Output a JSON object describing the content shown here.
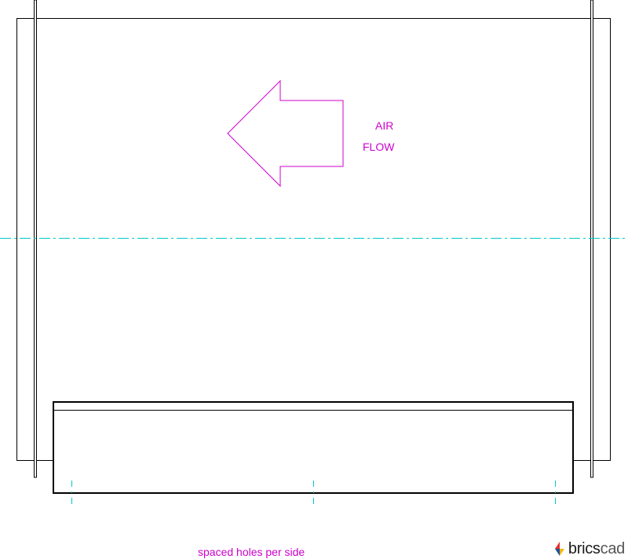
{
  "annotations": {
    "airflow_line1": "AIR",
    "airflow_line2": "FLOW",
    "holes_note": "spaced holes per side"
  },
  "logo": {
    "part_a": "brics",
    "part_b": "cad",
    "icon": "bricscad-logo-icon"
  },
  "colors": {
    "background": "#ffffff",
    "outline": "#000000",
    "annotation": "#cc00cc",
    "centerline": "#00c8c8",
    "logo_red": "#e5322d",
    "logo_blue": "#1e4fa0",
    "logo_yellow": "#f5b800"
  }
}
